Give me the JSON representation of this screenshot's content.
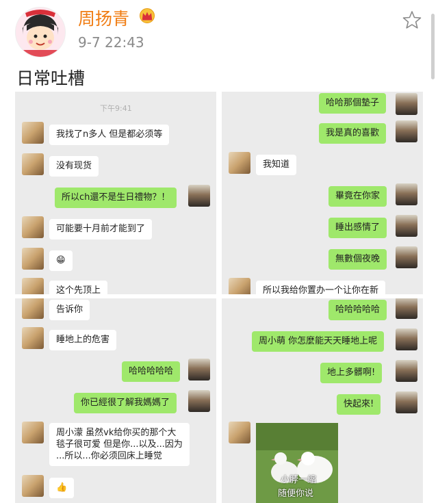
{
  "post": {
    "author": "周扬青",
    "timestamp": "9-7 22:43",
    "text": "日常吐槽"
  },
  "colors": {
    "author": "#f07c12",
    "outgoing_bubble": "#9fe86b",
    "incoming_bubble": "#ffffff",
    "panel_bg": "#ebebeb"
  },
  "icons": [
    "avatar-icon",
    "vip-crown-icon",
    "favorite-star-icon"
  ],
  "panel1": {
    "time": "下午9:41",
    "m1": "我找了n多人 但是都必须等",
    "m2": "没有现货",
    "m3": "所以ch還不是生日禮物？！",
    "m4": "可能要十月前才能到了",
    "m5": "😁",
    "m6": "这个先顶上"
  },
  "panel2": {
    "m1": "哈哈那個墊子",
    "m2": "我是真的喜歡",
    "m3": "我知道",
    "m4": "畢竟在你家",
    "m5": "睡出感情了",
    "m6": "無數個夜晚",
    "m7": "所以我给你置办一个让你在新"
  },
  "panel3": {
    "m1": "告诉你",
    "m2": "睡地上的危害",
    "m3": "哈哈哈哈哈",
    "m4": "你已經很了解我媽媽了",
    "m5a": "周小濛 虽然vk给你买的那个大",
    "m5b": "毯子很可爱 但是你...以及...因为",
    "m5c": "...所以...你必须回床上睡觉",
    "m6": "👍"
  },
  "panel4": {
    "m1": "哈哈哈哈哈",
    "m2": "周小萌 你怎麼能天天睡地上呢",
    "m3": "地上多髒啊!",
    "m4": "快起來!",
    "sticker_line1": "小脖一缩",
    "sticker_line2": "随便你说"
  }
}
